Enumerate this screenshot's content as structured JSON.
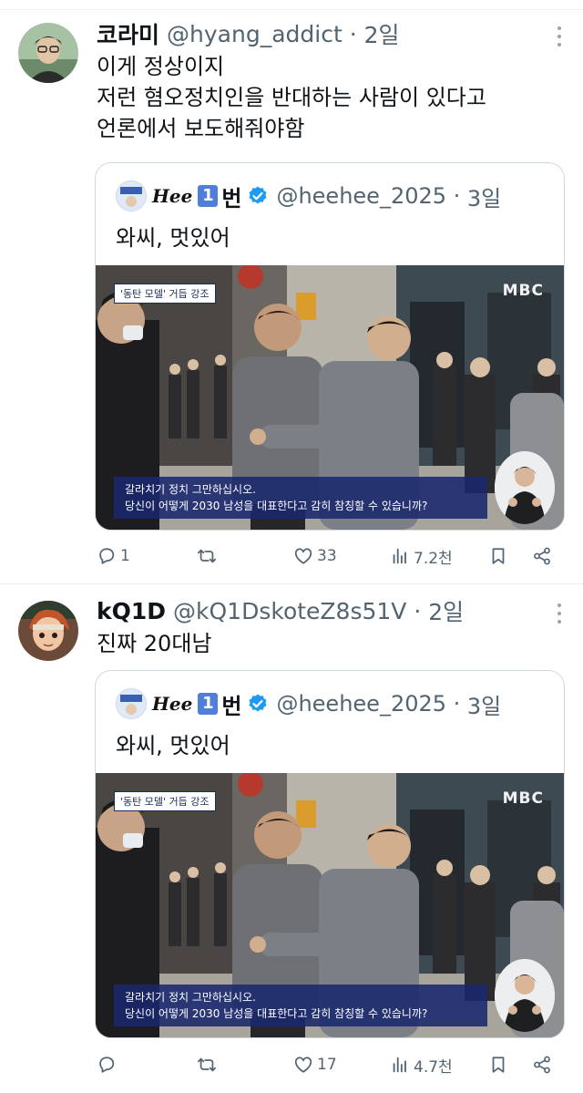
{
  "posts": [
    {
      "name": "코라미",
      "handle": "@hyang_addict",
      "time": "2일",
      "lines": [
        "이게 정상이지",
        "저런 혐오정치인을 반대하는 사람이 있다고",
        "언론에서 보도해줘야함"
      ],
      "quote": {
        "logo_text": "Hee",
        "badge_number": "1",
        "name_suffix": "번",
        "handle": "@heehee_2025",
        "time": "3일",
        "text": "와씨, 멋있어",
        "media": {
          "tag": "'동탄 모델' 거듭 강조",
          "broadcaster": "MBC",
          "caption_line1": "갈라치기 정치 그만하십시오.",
          "caption_line2": "당신이 어떻게 2030 남성을 대표한다고 감히 참칭할 수 있습니까?"
        }
      },
      "actions": {
        "replies": "1",
        "reposts": "",
        "likes": "33",
        "views": "7.2천"
      }
    },
    {
      "name": "kQ1D",
      "handle": "@kQ1DskoteZ8s51V",
      "time": "2일",
      "lines": [
        "진짜 20대남"
      ],
      "quote": {
        "logo_text": "Hee",
        "badge_number": "1",
        "name_suffix": "번",
        "handle": "@heehee_2025",
        "time": "3일",
        "text": "와씨, 멋있어",
        "media": {
          "tag": "'동탄 모델' 거듭 강조",
          "broadcaster": "MBC",
          "caption_line1": "갈라치기 정치 그만하십시오.",
          "caption_line2": "당신이 어떻게 2030 남성을 대표한다고 감히 참칭할 수 있습니까?"
        }
      },
      "actions": {
        "replies": "",
        "reposts": "",
        "likes": "17",
        "views": "4.7천"
      }
    }
  ],
  "icons": {
    "more": "more-vertical-icon",
    "reply": "reply-icon",
    "repost": "repost-icon",
    "like": "heart-icon",
    "views": "views-icon",
    "bookmark": "bookmark-icon",
    "share": "share-icon",
    "verified": "verified-badge-icon"
  },
  "colors": {
    "text": "#0f1419",
    "secondary": "#536471",
    "border": "#cfd9de",
    "verified": "#1d9bf0",
    "caption_bg": "#1a286e"
  }
}
